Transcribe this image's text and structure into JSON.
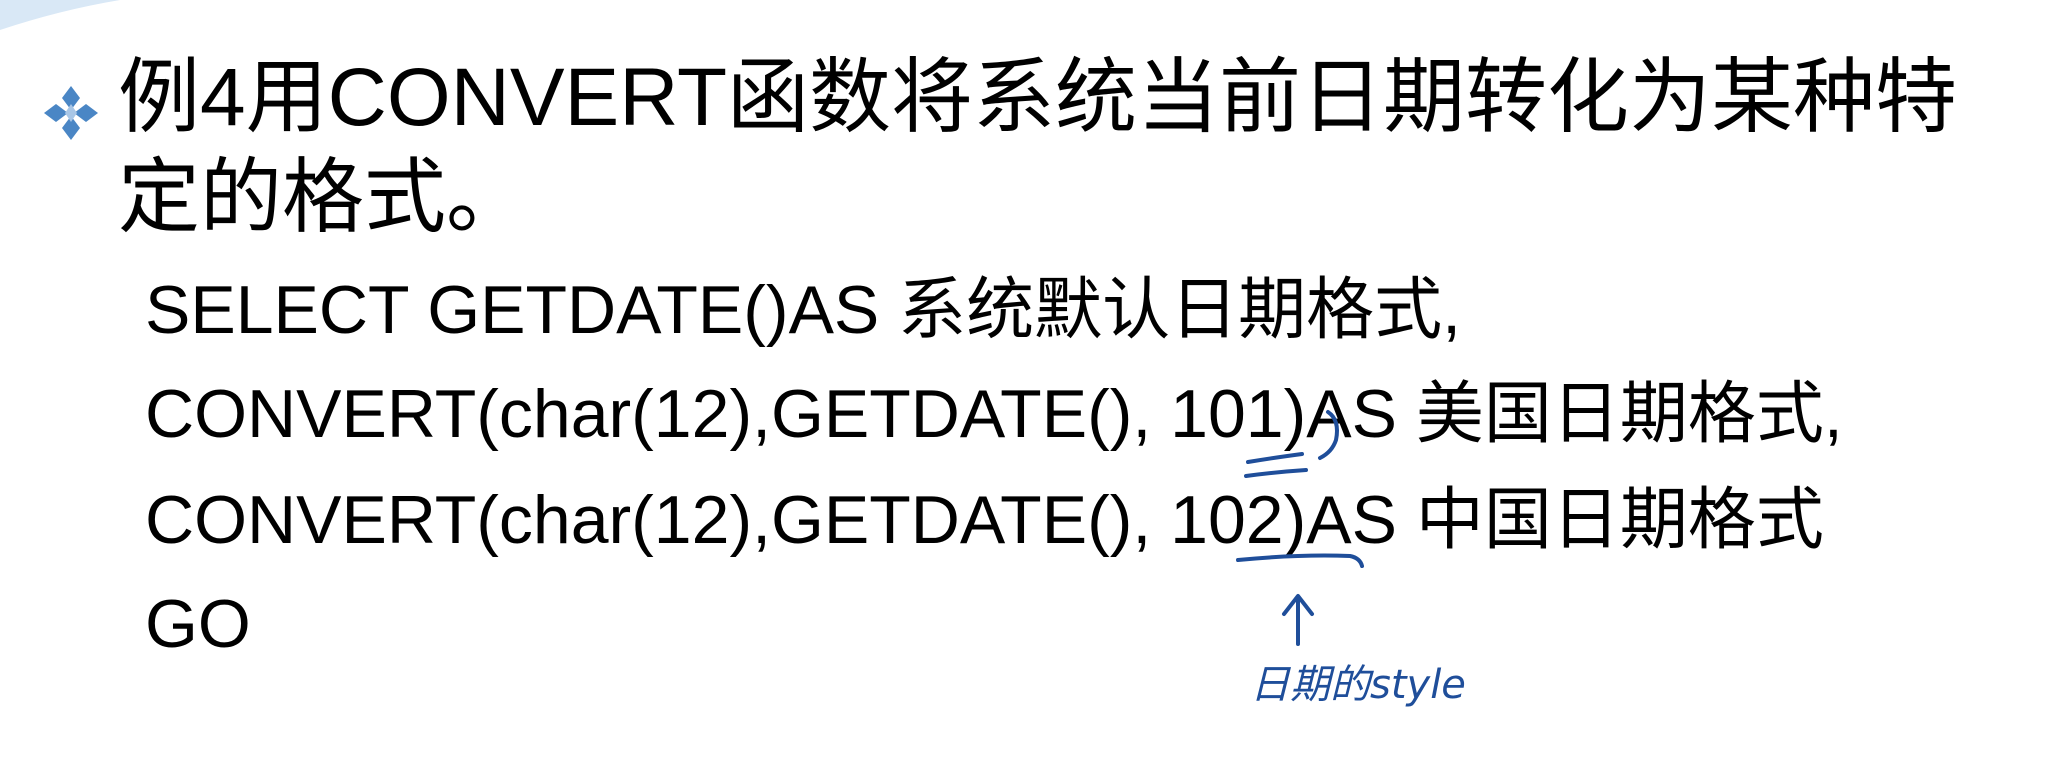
{
  "slide": {
    "accent_color": "#4a86c5",
    "ink_color": "#1f4e9a",
    "bullet_icon": "diamond-cluster-icon",
    "title": "例4用CONVERT函数将系统当前日期转化为某种特定的格式。",
    "code_lines": [
      "SELECT GETDATE()AS 系统默认日期格式,",
      "CONVERT(char(12),GETDATE(), 101)AS 美国日期格式,",
      "CONVERT(char(12),GETDATE(), 102)AS 中国日期格式",
      "GO"
    ],
    "handwritten_note": "日期的style"
  }
}
